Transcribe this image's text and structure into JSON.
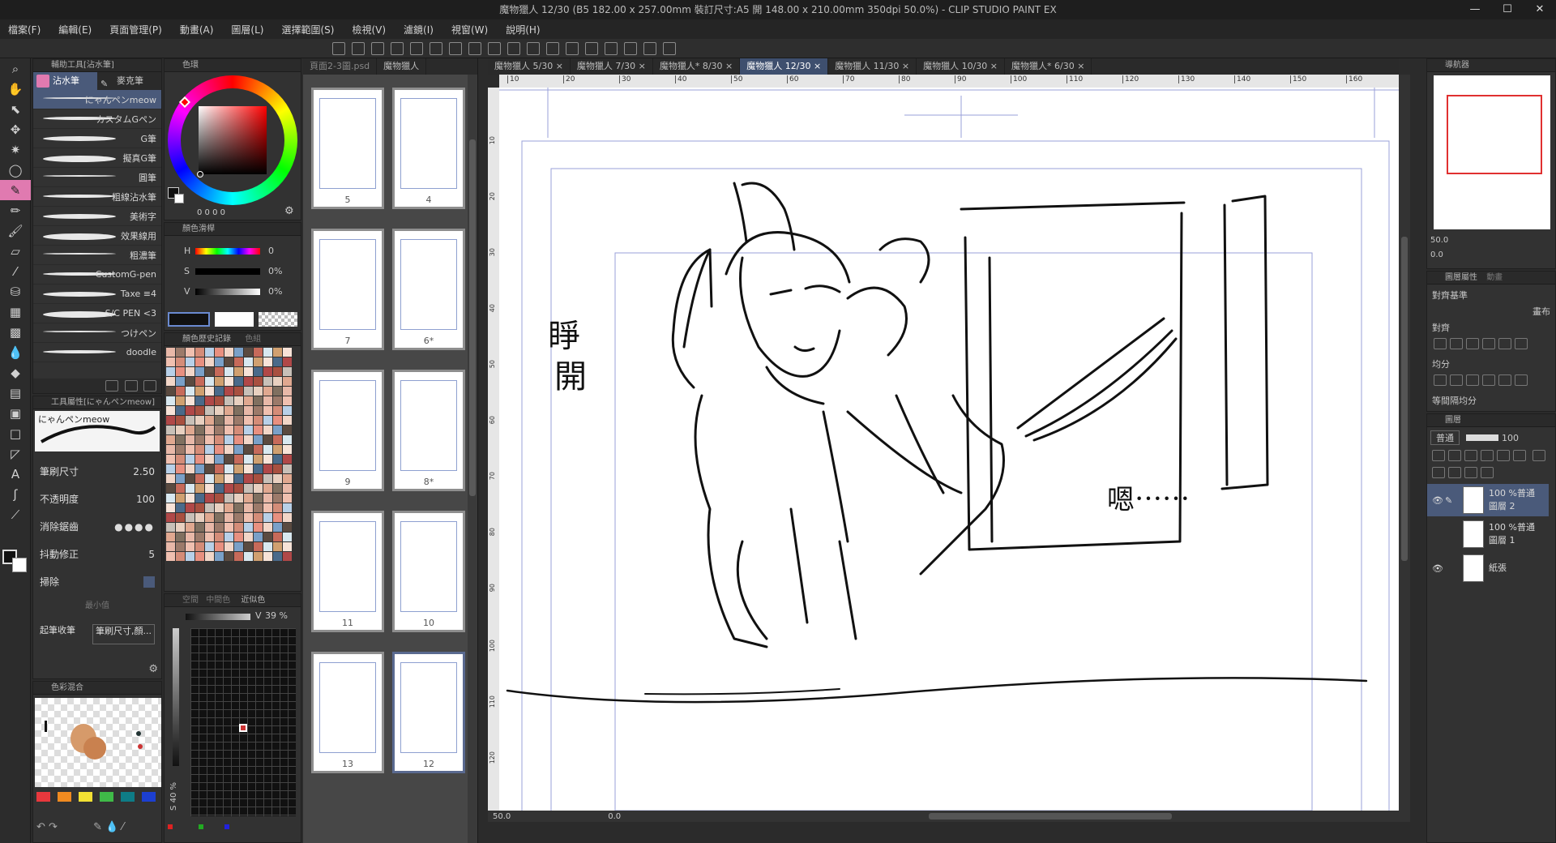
{
  "window": {
    "title": "魔物獵人 12/30 (B5 182.00 x 257.00mm 裝訂尺寸:A5 開 148.00 x 210.00mm 350dpi 50.0%) - CLIP STUDIO PAINT EX"
  },
  "menu": [
    "檔案(F)",
    "編輯(E)",
    "頁面管理(P)",
    "動畫(A)",
    "圖層(L)",
    "選擇範圍(S)",
    "檢視(V)",
    "濾鏡(I)",
    "視窗(W)",
    "說明(H)"
  ],
  "sub_tool": {
    "panel_title": "輔助工具[沾水筆]",
    "tabs": [
      "沾水筆",
      "麥克筆"
    ],
    "brushes": [
      "にゃんペンmeow",
      "カスタムGペン",
      "G筆",
      "擬真G筆",
      "圓筆",
      "粗線沾水筆",
      "美術字",
      "效果線用",
      "粗濃筆",
      "CustomG-pen",
      "Taxe ≡4",
      "S/C PEN <3",
      "つけペン",
      "doodle"
    ]
  },
  "tool_property": {
    "panel_title": "工具屬性[にゃんペンmeow]",
    "brush_name": "にゃんペンmeow",
    "size_label": "筆刷尺寸",
    "size_value": "2.50",
    "opacity_label": "不透明度",
    "opacity_value": "100",
    "aa_label": "消除鋸齒",
    "stabilizer_label": "抖動修正",
    "stabilizer_value": "5",
    "post_label": "掃除",
    "min_label": "最小值",
    "taper_label": "起筆收筆",
    "taper_value": "筆刷尺寸,顏..."
  },
  "color_panel": {
    "title": "色環",
    "h": "0",
    "s": "0%",
    "v": "0%",
    "readout": "0 0 0 0",
    "slider_title": "顏色滑桿",
    "history_title": "顏色歷史記錄",
    "history_tab2": "色組",
    "similar_tab1": "空間",
    "similar_tab2": "中間色",
    "similar_tab3": "近似色",
    "v_label": "V",
    "v_value": "39 %",
    "s_side": "S 40 %"
  },
  "mix_panel": {
    "title": "色彩混合"
  },
  "pages": {
    "tabs": [
      "頁面2-3圖.psd",
      "魔物獵人"
    ],
    "thumbs": [
      {
        "num": "5"
      },
      {
        "num": "4"
      },
      {
        "num": "7"
      },
      {
        "num": "6*"
      },
      {
        "num": "9"
      },
      {
        "num": "8*"
      },
      {
        "num": "11"
      },
      {
        "num": "10"
      },
      {
        "num": "13"
      },
      {
        "num": "12"
      }
    ]
  },
  "doc_tabs": [
    {
      "label": "魔物獵人 5/30",
      "active": false
    },
    {
      "label": "魔物獵人 7/30",
      "active": false
    },
    {
      "label": "魔物獵人* 8/30",
      "active": false
    },
    {
      "label": "魔物獵人 12/30",
      "active": true
    },
    {
      "label": "魔物獵人 11/30",
      "active": false
    },
    {
      "label": "魔物獵人 10/30",
      "active": false
    },
    {
      "label": "魔物獵人* 6/30",
      "active": false
    }
  ],
  "ruler": {
    "top": [
      "10",
      "20",
      "30",
      "40",
      "50",
      "60",
      "70",
      "80",
      "90",
      "100",
      "110",
      "120",
      "130",
      "140",
      "150",
      "160"
    ],
    "left": [
      "10",
      "20",
      "30",
      "40",
      "50",
      "60",
      "70",
      "80",
      "90",
      "100",
      "110",
      "120"
    ]
  },
  "canvas": {
    "text1a": "睜",
    "text1b": "開",
    "text2": "嗯⋯⋯"
  },
  "status": {
    "zoom": "50.0",
    "angle": "0.0"
  },
  "navigator": {
    "title": "導航器",
    "zoom": "50.0",
    "angle": "0.0"
  },
  "layer_property": {
    "tab1": "圖層屬性",
    "tab2": "動畫",
    "label_align": "對齊基準",
    "canvas_label": "畫布",
    "align_label": "對齊",
    "distribute_label": "均分",
    "equal_label": "等間隔均分"
  },
  "layers": {
    "tab": "圖層",
    "blend": "普通",
    "opacity": "100",
    "items": [
      {
        "line1": "100 %普通",
        "line2": "圖層 2"
      },
      {
        "line1": "100 %普通",
        "line2": "圖層 1"
      },
      {
        "line1": "",
        "line2": "紙張"
      }
    ]
  },
  "colors": {
    "accent": "#e07ab0",
    "active_tab": "#3e4f6e",
    "palette_bottom": [
      "#e8383d",
      "#f08a20",
      "#f2e033",
      "#3fba48",
      "#0e7c86",
      "#1c3fd1"
    ]
  }
}
